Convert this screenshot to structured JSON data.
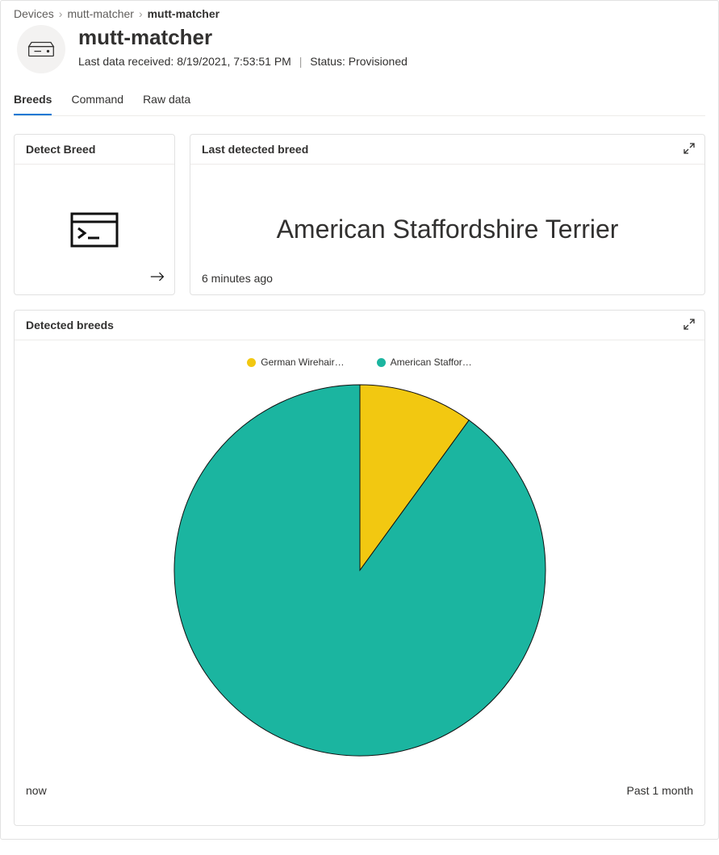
{
  "breadcrumb": {
    "root": "Devices",
    "mid": "mutt-matcher",
    "current": "mutt-matcher"
  },
  "header": {
    "title": "mutt-matcher",
    "last_data_prefix": "Last data received: ",
    "last_data_time": "8/19/2021, 7:53:51 PM",
    "status_prefix": "Status: ",
    "status_value": "Provisioned"
  },
  "tabs": {
    "breeds": "Breeds",
    "command": "Command",
    "rawdata": "Raw data"
  },
  "cards": {
    "detect_title": "Detect Breed",
    "last_title": "Last detected breed",
    "last_value": "American Staffordshire Terrier",
    "last_time": "6 minutes ago",
    "chart_title": "Detected breeds",
    "chart_left_label": "now",
    "chart_right_label": "Past 1 month"
  },
  "colors": {
    "german": "#f2c811",
    "american": "#1bb5a0"
  },
  "chart_data": {
    "type": "pie",
    "title": "Detected breeds",
    "series": [
      {
        "name": "German Wirehair…",
        "value": 10,
        "color": "#f2c811"
      },
      {
        "name": "American Staffor…",
        "value": 90,
        "color": "#1bb5a0"
      }
    ],
    "time_range": {
      "from": "now",
      "to": "Past 1 month"
    }
  }
}
